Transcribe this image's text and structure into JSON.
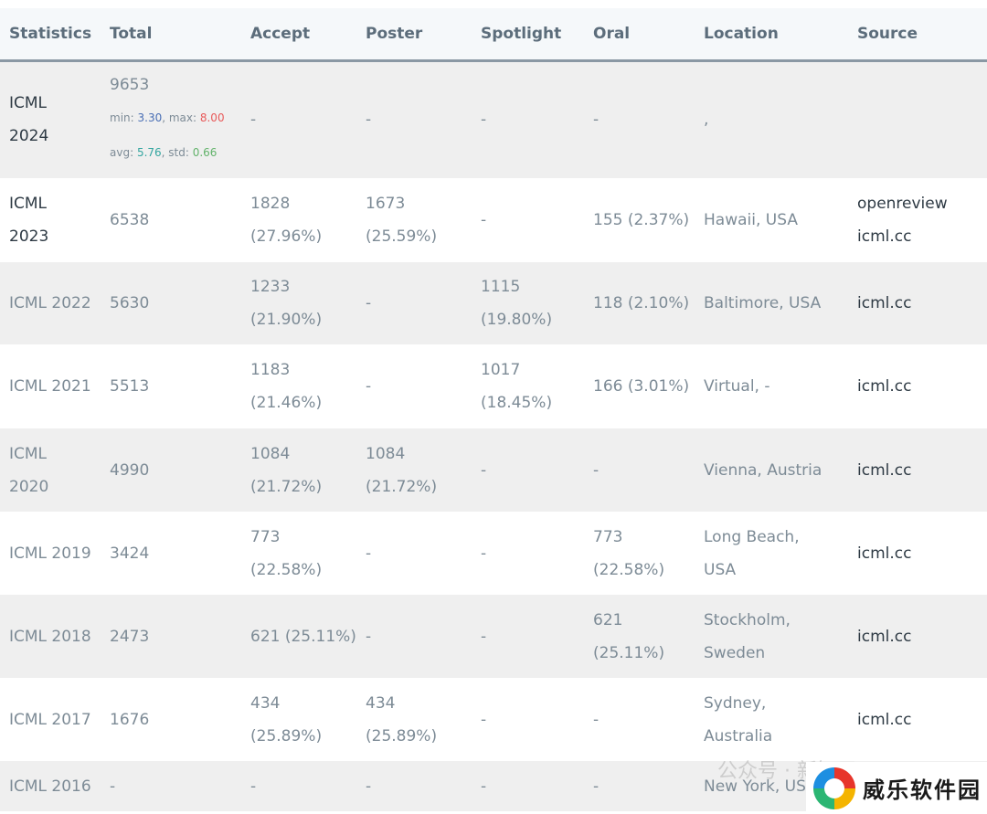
{
  "table": {
    "headers": [
      "Statistics",
      "Total",
      "Accept",
      "Poster",
      "Spotlight",
      "Oral",
      "Location",
      "Source"
    ],
    "row2024": {
      "name_line1": "ICML",
      "name_line2": "2024",
      "total": "9653",
      "min_label": "min: ",
      "min_value": "3.30",
      "max_label": ", max: ",
      "max_value": "8.00",
      "avg_label": "avg: ",
      "avg_value": "5.76",
      "std_label": ", std: ",
      "std_value": "0.66",
      "accept": "-",
      "poster": "-",
      "spotlight": "-",
      "oral": "-",
      "location": ",",
      "source": ""
    },
    "row2023": {
      "name_line1": "ICML",
      "name_line2": "2023",
      "total": "6538",
      "accept_line1": "1828",
      "accept_line2": "(27.96%)",
      "poster_line1": "1673",
      "poster_line2": "(25.59%)",
      "spotlight": "-",
      "oral": "155 (2.37%)",
      "location": "Hawaii, USA",
      "source_line1": "openreview",
      "source_line2": "icml.cc"
    },
    "row2022": {
      "name": "ICML 2022",
      "total": "5630",
      "accept_line1": "1233",
      "accept_line2": "(21.90%)",
      "poster": "-",
      "spotlight_line1": "1115",
      "spotlight_line2": "(19.80%)",
      "oral": "118 (2.10%)",
      "location": "Baltimore, USA",
      "source": "icml.cc"
    },
    "row2021": {
      "name": "ICML 2021",
      "total": "5513",
      "accept_line1": "1183",
      "accept_line2": "(21.46%)",
      "poster": "-",
      "spotlight_line1": "1017",
      "spotlight_line2": "(18.45%)",
      "oral": "166 (3.01%)",
      "location": "Virtual, -",
      "source": "icml.cc"
    },
    "row2020": {
      "name_line1": "ICML",
      "name_line2": "2020",
      "total": "4990",
      "accept_line1": "1084",
      "accept_line2": "(21.72%)",
      "poster_line1": "1084",
      "poster_line2": "(21.72%)",
      "spotlight": "-",
      "oral": "-",
      "location": "Vienna, Austria",
      "source": "icml.cc"
    },
    "row2019": {
      "name": "ICML 2019",
      "total": "3424",
      "accept_line1": "773",
      "accept_line2": "(22.58%)",
      "poster": "-",
      "spotlight": "-",
      "oral_line1": "773",
      "oral_line2": "(22.58%)",
      "location_line1": "Long Beach,",
      "location_line2": "USA",
      "source": "icml.cc"
    },
    "row2018": {
      "name": "ICML 2018",
      "total": "2473",
      "accept": "621 (25.11%)",
      "poster": "-",
      "spotlight": "-",
      "oral_line1": "621",
      "oral_line2": "(25.11%)",
      "location_line1": "Stockholm,",
      "location_line2": "Sweden",
      "source": "icml.cc"
    },
    "row2017": {
      "name": "ICML 2017",
      "total": "1676",
      "accept_line1": "434",
      "accept_line2": "(25.89%)",
      "poster_line1": "434",
      "poster_line2": "(25.89%)",
      "spotlight": "-",
      "oral": "-",
      "location_line1": "Sydney,",
      "location_line2": "Australia",
      "source": "icml.cc"
    },
    "row2016": {
      "name": "ICML 2016",
      "total": "-",
      "accept": "-",
      "poster": "-",
      "spotlight": "-",
      "oral": "-",
      "location": "New York, US"
    }
  },
  "watermark": "公众号 · 新智元",
  "logo_text": "威乐软件园"
}
